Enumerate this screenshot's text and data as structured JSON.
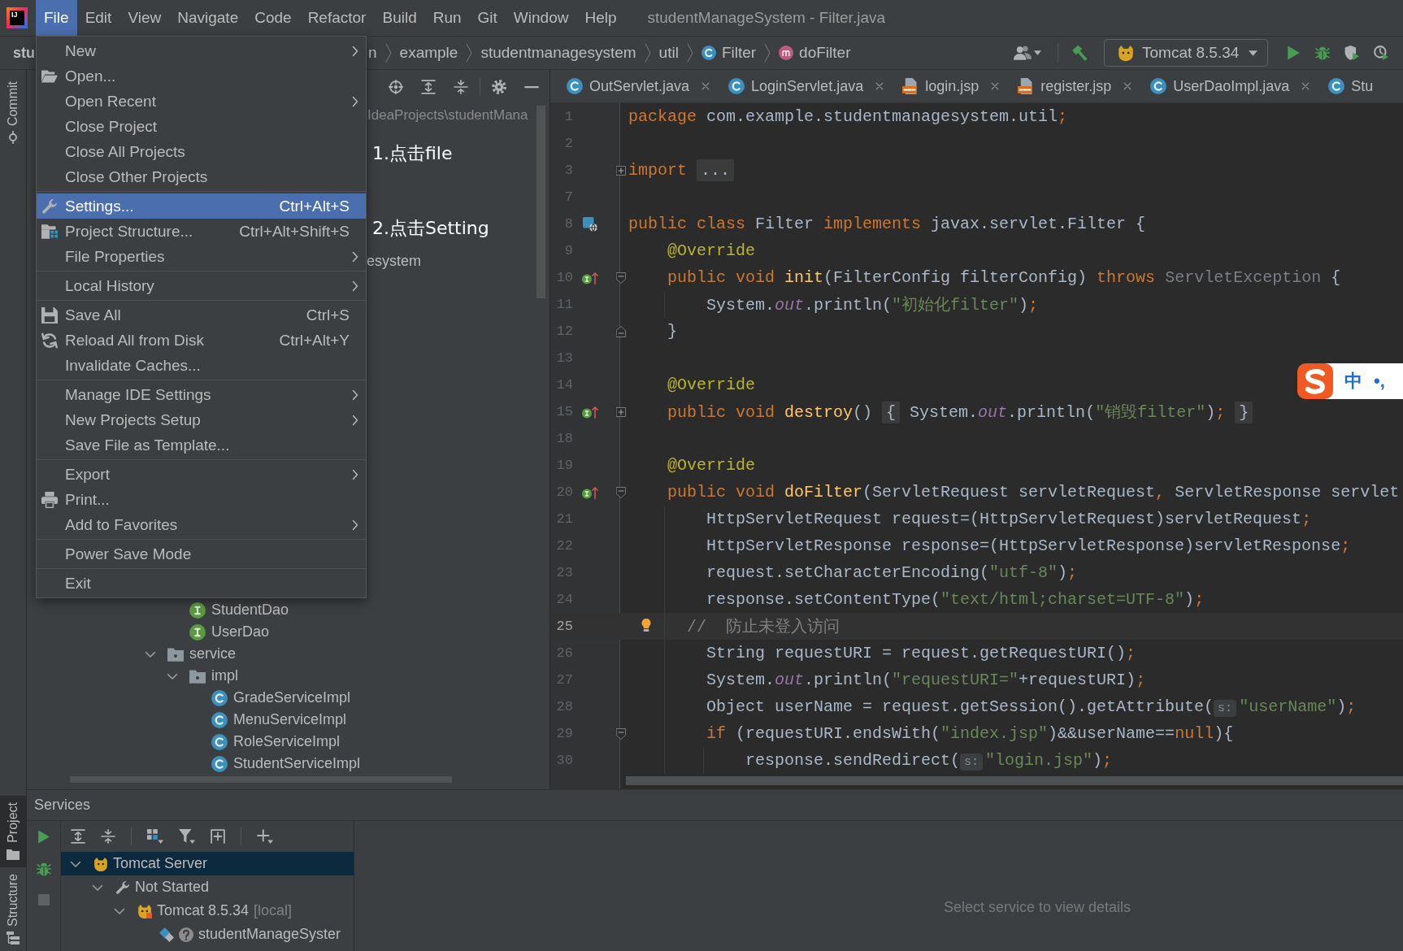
{
  "menu_bar": {
    "logo": "IJ",
    "items": [
      {
        "label": "File",
        "selected": true
      },
      {
        "label": "Edit",
        "selected": false
      },
      {
        "label": "View",
        "selected": false
      },
      {
        "label": "Navigate",
        "selected": false
      },
      {
        "label": "Code",
        "selected": false
      },
      {
        "label": "Refactor",
        "selected": false
      },
      {
        "label": "Build",
        "selected": false
      },
      {
        "label": "Run",
        "selected": false
      },
      {
        "label": "Git",
        "selected": false
      },
      {
        "label": "Window",
        "selected": false
      },
      {
        "label": "Help",
        "selected": false
      }
    ],
    "title": "studentManageSystem - Filter.java"
  },
  "file_menu": {
    "groups": [
      [
        {
          "label": "New",
          "kind": "plain",
          "submenu": true,
          "selected": false
        },
        {
          "label": "Open...",
          "kind": "open",
          "submenu": false,
          "selected": false
        },
        {
          "label": "Open Recent",
          "kind": "plain",
          "submenu": true,
          "selected": false
        },
        {
          "label": "Close Project",
          "kind": "plain",
          "submenu": false,
          "selected": false
        },
        {
          "label": "Close All Projects",
          "kind": "plain",
          "submenu": false,
          "selected": false
        },
        {
          "label": "Close Other Projects",
          "kind": "plain",
          "submenu": false,
          "selected": false
        }
      ],
      [
        {
          "label": "Settings...",
          "kind": "settings",
          "shortcut": "Ctrl+Alt+S",
          "submenu": false,
          "selected": true
        },
        {
          "label": "Project Structure...",
          "kind": "structure",
          "shortcut": "Ctrl+Alt+Shift+S",
          "submenu": false,
          "selected": false
        },
        {
          "label": "File Properties",
          "kind": "plain",
          "submenu": true,
          "selected": false
        }
      ],
      [
        {
          "label": "Local History",
          "kind": "plain",
          "submenu": true,
          "selected": false
        }
      ],
      [
        {
          "label": "Save All",
          "kind": "save",
          "shortcut": "Ctrl+S",
          "submenu": false,
          "selected": false
        },
        {
          "label": "Reload All from Disk",
          "kind": "reload",
          "shortcut": "Ctrl+Alt+Y",
          "submenu": false,
          "selected": false
        },
        {
          "label": "Invalidate Caches...",
          "kind": "plain",
          "submenu": false,
          "selected": false
        }
      ],
      [
        {
          "label": "Manage IDE Settings",
          "kind": "plain",
          "submenu": true,
          "selected": false
        },
        {
          "label": "New Projects Setup",
          "kind": "plain",
          "submenu": true,
          "selected": false
        },
        {
          "label": "Save File as Template...",
          "kind": "plain",
          "submenu": false,
          "selected": false
        }
      ],
      [
        {
          "label": "Export",
          "kind": "plain",
          "submenu": true,
          "selected": false
        },
        {
          "label": "Print...",
          "kind": "print",
          "submenu": false,
          "selected": false
        },
        {
          "label": "Add to Favorites",
          "kind": "plain",
          "submenu": true,
          "selected": false
        }
      ],
      [
        {
          "label": "Power Save Mode",
          "kind": "plain",
          "submenu": false,
          "selected": false
        }
      ],
      [
        {
          "label": "Exit",
          "kind": "plain",
          "submenu": false,
          "selected": false
        }
      ]
    ]
  },
  "annotations": [
    {
      "text": "1.点击file"
    },
    {
      "text": "2.点击Setting"
    }
  ],
  "nav_bar": {
    "project": "stu",
    "breadcrumbs": [
      {
        "label": "n",
        "kind": "folder"
      },
      {
        "label": "example",
        "kind": "folder"
      },
      {
        "label": "studentmanagesystem",
        "kind": "folder"
      },
      {
        "label": "util",
        "kind": "folder"
      },
      {
        "label": "Filter",
        "kind": "class"
      },
      {
        "label": "doFilter",
        "kind": "method"
      }
    ],
    "run_config": "Tomcat 8.5.34"
  },
  "tool_strip": {
    "top": [
      {
        "label": "Commit",
        "kind": "commit",
        "selected": false
      }
    ],
    "bottom": [
      {
        "label": "Project",
        "kind": "project",
        "selected": true
      },
      {
        "label": "Structure",
        "kind": "structure",
        "selected": false
      }
    ]
  },
  "project_panel": {
    "path": "IdeaProjects\\studentMana",
    "partial_row": "esystem",
    "tree": [
      {
        "children": [
          {
            "label": "StudentDao",
            "kind": "interface",
            "selected": false
          },
          {
            "label": "UserDao",
            "kind": "interface",
            "selected": false
          }
        ]
      },
      {
        "label": "service",
        "kind": "folder",
        "expanded": true,
        "selected": false,
        "children": [
          {
            "label": "impl",
            "kind": "folder",
            "expanded": true,
            "selected": false,
            "children": [
              {
                "label": "GradeServiceImpl",
                "kind": "class",
                "selected": false
              },
              {
                "label": "MenuServiceImpl",
                "kind": "class",
                "selected": false
              },
              {
                "label": "RoleServiceImpl",
                "kind": "class",
                "selected": false
              },
              {
                "label": "StudentServiceImpl",
                "kind": "class",
                "selected": false
              }
            ]
          }
        ]
      }
    ]
  },
  "editor": {
    "tabs": [
      {
        "label": "OutServlet.java",
        "kind": "class",
        "selected": false,
        "closable": true
      },
      {
        "label": "LoginServlet.java",
        "kind": "class",
        "selected": false,
        "closable": true
      },
      {
        "label": "login.jsp",
        "kind": "jsp",
        "selected": false,
        "closable": true
      },
      {
        "label": "register.jsp",
        "kind": "jsp",
        "selected": false,
        "closable": true
      },
      {
        "label": "UserDaoImpl.java",
        "kind": "class",
        "selected": false,
        "closable": true
      },
      {
        "label": "Stu",
        "kind": "class",
        "selected": false,
        "closable": false
      }
    ],
    "lines": [
      {
        "number": "1",
        "current": false,
        "tokens": [
          {
            "text": "package",
            "kind": "kw"
          },
          {
            "text": " com.example.studentmanagesystem.util",
            "kind": "plain"
          },
          {
            "text": ";",
            "kind": "kw"
          }
        ]
      },
      {
        "number": "2",
        "current": false
      },
      {
        "number": "3",
        "current": false,
        "gutter": [
          {
            "kind": "fold_collapsed"
          }
        ],
        "tokens": [
          {
            "text": "import ",
            "kind": "kw"
          },
          {
            "text": "...",
            "kind": "folded"
          }
        ]
      },
      {
        "number": "7",
        "current": false
      },
      {
        "number": "8",
        "current": false,
        "gutter": [
          {
            "kind": "web"
          }
        ],
        "tokens": [
          {
            "text": "public class ",
            "kind": "kw"
          },
          {
            "text": "Filter ",
            "kind": "plain"
          },
          {
            "text": "implements ",
            "kind": "kw"
          },
          {
            "text": "javax.servlet.Filter {",
            "kind": "plain"
          }
        ],
        "children": [
          {
            "number": "9",
            "current": false,
            "tokens": [
              {
                "text": "@Override",
                "kind": "annotation"
              }
            ]
          },
          {
            "number": "10",
            "current": false,
            "gutter": [
              {
                "kind": "implements"
              },
              {
                "kind": "fold_start"
              }
            ],
            "tokens": [
              {
                "text": "public void ",
                "kind": "kw"
              },
              {
                "text": "init",
                "kind": "method"
              },
              {
                "text": "(FilterConfig filterConfig) ",
                "kind": "plain"
              },
              {
                "text": "throws ",
                "kind": "kw"
              },
              {
                "text": "ServletException",
                "kind": "unused"
              },
              {
                "text": " {",
                "kind": "plain"
              }
            ],
            "children": [
              {
                "number": "11",
                "current": false,
                "tokens": [
                  {
                    "text": "System.",
                    "kind": "plain"
                  },
                  {
                    "text": "out",
                    "kind": "field"
                  },
                  {
                    "text": ".println(",
                    "kind": "plain"
                  },
                  {
                    "text": "\"初始化filter\"",
                    "kind": "string"
                  },
                  {
                    "text": ")",
                    "kind": "plain"
                  },
                  {
                    "text": ";",
                    "kind": "kw"
                  }
                ]
              }
            ]
          },
          {
            "number": "12",
            "current": false,
            "gutter": [
              {
                "kind": "fold_end"
              }
            ],
            "tokens": [
              {
                "text": "}",
                "kind": "plain"
              }
            ]
          },
          {
            "number": "13",
            "current": false
          },
          {
            "number": "14",
            "current": false,
            "tokens": [
              {
                "text": "@Override",
                "kind": "annotation"
              }
            ]
          },
          {
            "number": "15",
            "current": false,
            "gutter": [
              {
                "kind": "implements"
              },
              {
                "kind": "fold_collapsed"
              }
            ],
            "tokens": [
              {
                "text": "public void ",
                "kind": "kw"
              },
              {
                "text": "destroy",
                "kind": "method"
              },
              {
                "text": "() ",
                "kind": "plain"
              },
              {
                "text": "{",
                "kind": "folded"
              },
              {
                "text": " System.",
                "kind": "plain"
              },
              {
                "text": "out",
                "kind": "field"
              },
              {
                "text": ".println(",
                "kind": "plain"
              },
              {
                "text": "\"销毁filter\"",
                "kind": "string"
              },
              {
                "text": ")",
                "kind": "plain"
              },
              {
                "text": "; ",
                "kind": "kw"
              },
              {
                "text": "}",
                "kind": "folded"
              }
            ]
          },
          {
            "number": "18",
            "current": false
          },
          {
            "number": "19",
            "current": false,
            "tokens": [
              {
                "text": "@Override",
                "kind": "annotation"
              }
            ]
          },
          {
            "number": "20",
            "current": false,
            "gutter": [
              {
                "kind": "implements"
              },
              {
                "kind": "fold_start"
              }
            ],
            "tokens": [
              {
                "text": "public void ",
                "kind": "kw"
              },
              {
                "text": "doFilter",
                "kind": "method"
              },
              {
                "text": "(ServletRequest servletRequest",
                "kind": "plain"
              },
              {
                "text": ", ",
                "kind": "kw"
              },
              {
                "text": "ServletResponse servlet",
                "kind": "plain"
              }
            ],
            "children": [
              {
                "number": "21",
                "current": false,
                "tokens": [
                  {
                    "text": "HttpServletRequest request=(HttpServletRequest)servletRequest",
                    "kind": "plain"
                  },
                  {
                    "text": ";",
                    "kind": "kw"
                  }
                ]
              },
              {
                "number": "22",
                "current": false,
                "tokens": [
                  {
                    "text": "HttpServletResponse response=(HttpServletResponse)servletResponse",
                    "kind": "plain"
                  },
                  {
                    "text": ";",
                    "kind": "kw"
                  }
                ]
              },
              {
                "number": "23",
                "current": false,
                "tokens": [
                  {
                    "text": "request.setCharacterEncoding(",
                    "kind": "plain"
                  },
                  {
                    "text": "\"utf-8\"",
                    "kind": "string"
                  },
                  {
                    "text": ")",
                    "kind": "plain"
                  },
                  {
                    "text": ";",
                    "kind": "kw"
                  }
                ]
              },
              {
                "number": "24",
                "current": false,
                "tokens": [
                  {
                    "text": "response.setContentType(",
                    "kind": "plain"
                  },
                  {
                    "text": "\"text/html;charset=UTF-8\"",
                    "kind": "string"
                  },
                  {
                    "text": ")",
                    "kind": "plain"
                  },
                  {
                    "text": ";",
                    "kind": "kw"
                  }
                ]
              },
              {
                "number": "25",
                "current": true,
                "gutter": [
                  {
                    "kind": "bulb"
                  }
                ],
                "tokens": [
                  {
                    "text": "//  防止未登入访问",
                    "kind": "comment"
                  }
                ]
              },
              {
                "number": "26",
                "current": false,
                "tokens": [
                  {
                    "text": "String requestURI = request.getRequestURI()",
                    "kind": "plain"
                  },
                  {
                    "text": ";",
                    "kind": "kw"
                  }
                ]
              },
              {
                "number": "27",
                "current": false,
                "tokens": [
                  {
                    "text": "System.",
                    "kind": "plain"
                  },
                  {
                    "text": "out",
                    "kind": "field"
                  },
                  {
                    "text": ".println(",
                    "kind": "plain"
                  },
                  {
                    "text": "\"requestURI=\"",
                    "kind": "string"
                  },
                  {
                    "text": "+requestURI)",
                    "kind": "plain"
                  },
                  {
                    "text": ";",
                    "kind": "kw"
                  }
                ]
              },
              {
                "number": "28",
                "current": false,
                "tokens": [
                  {
                    "text": "Object userName = request.getSession().getAttribute(",
                    "kind": "plain"
                  },
                  {
                    "text": "s:",
                    "kind": "hint"
                  },
                  {
                    "text": "\"userName\"",
                    "kind": "string"
                  },
                  {
                    "text": ")",
                    "kind": "plain"
                  },
                  {
                    "text": ";",
                    "kind": "kw"
                  }
                ]
              },
              {
                "number": "29",
                "current": false,
                "gutter": [
                  {
                    "kind": "fold_start"
                  }
                ],
                "tokens": [
                  {
                    "text": "if ",
                    "kind": "kw"
                  },
                  {
                    "text": "(requestURI.endsWith(",
                    "kind": "plain"
                  },
                  {
                    "text": "\"index.jsp\"",
                    "kind": "string"
                  },
                  {
                    "text": ")&&userName==",
                    "kind": "plain"
                  },
                  {
                    "text": "null",
                    "kind": "kw"
                  },
                  {
                    "text": "){",
                    "kind": "plain"
                  }
                ],
                "children": [
                  {
                    "number": "30",
                    "current": false,
                    "tokens": [
                      {
                        "text": "response.sendRedirect(",
                        "kind": "plain"
                      },
                      {
                        "text": "s:",
                        "kind": "hint"
                      },
                      {
                        "text": "\"login.jsp\"",
                        "kind": "string"
                      },
                      {
                        "text": ")",
                        "kind": "plain"
                      },
                      {
                        "text": ";",
                        "kind": "kw"
                      }
                    ]
                  }
                ]
              }
            ]
          }
        ]
      }
    ]
  },
  "ime": {
    "mode": "中",
    "punctuation": "•,"
  },
  "services": {
    "title": "Services",
    "tree": [
      {
        "label": "Tomcat Server",
        "kind": "server",
        "expanded": true,
        "selected": true,
        "children": [
          {
            "label": "Not Started",
            "kind": "group",
            "expanded": true,
            "selected": false,
            "children": [
              {
                "label": "Tomcat 8.5.34",
                "note": "[local]",
                "kind": "instance",
                "expanded": true,
                "selected": false,
                "children": [
                  {
                    "label": "studentManageSyster",
                    "kind": "artifact",
                    "selected": false
                  }
                ]
              }
            ]
          }
        ]
      }
    ],
    "detail": "Select service to view details"
  }
}
